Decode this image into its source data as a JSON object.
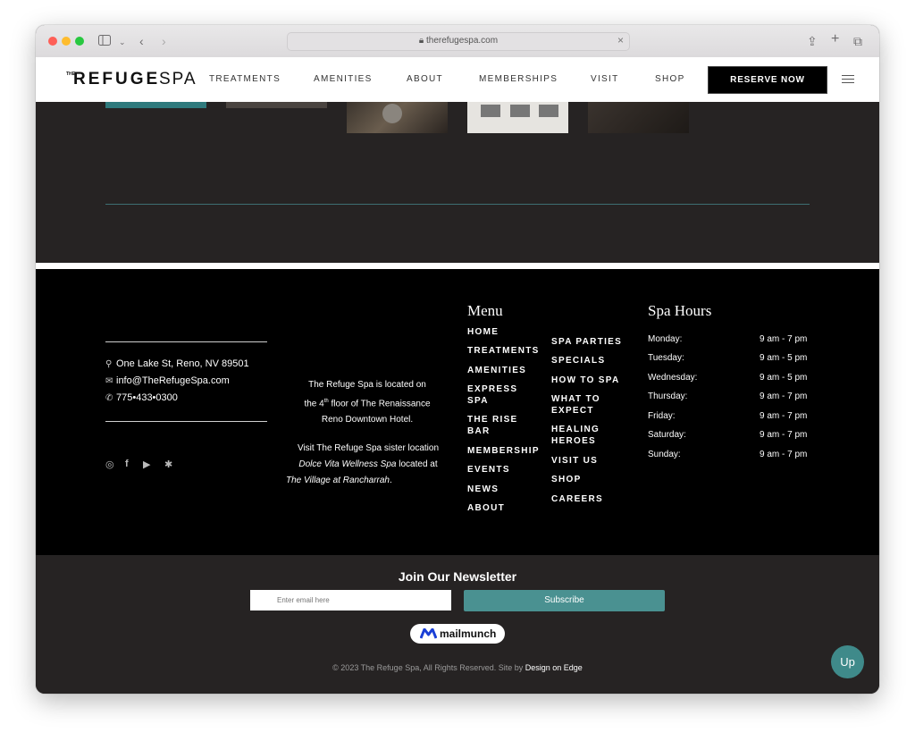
{
  "browser": {
    "url": "therefugespa.com"
  },
  "header": {
    "logo_small": "THE",
    "logo_main": "REFUGE",
    "logo_suffix": "SPA",
    "nav": [
      "TREATMENTS",
      "AMENITIES",
      "ABOUT",
      "MEMBERSHIPS",
      "VISIT",
      "SHOP"
    ],
    "reserve_label": "RESERVE NOW"
  },
  "contact": {
    "address": "One Lake St, Reno, NV 89501",
    "email": "info@TheRefugeSpa.com",
    "phone": "775•433•0300"
  },
  "about": {
    "line1": "The Refuge Spa is located on",
    "line2_pre": "the 4",
    "line2_sup": "th",
    "line2_post": " floor of The Renaissance",
    "line3": "Reno Downtown Hotel.",
    "line4": "Visit The Refuge Spa sister location",
    "line5_em": "Dolce Vita Wellness Spa",
    "line5_rest": " located at",
    "line6_em": "The Village at Rancharrah",
    "line6_rest": "."
  },
  "menu": {
    "heading": "Menu",
    "col1": [
      "HOME",
      "TREATMENTS",
      "AMENITIES",
      "EXPRESS\nSPA",
      "THE RISE\nBAR",
      "MEMBERSHIP",
      "EVENTS",
      "NEWS",
      "ABOUT"
    ],
    "col2": [
      "SPA PARTIES",
      "SPECIALS",
      "HOW TO SPA",
      "WHAT TO\nEXPECT",
      "HEALING\nHEROES",
      "VISIT US",
      "SHOP",
      "CAREERS"
    ]
  },
  "hours": {
    "heading": "Spa Hours",
    "rows": [
      {
        "day": "Monday:",
        "time": "9 am - 7 pm"
      },
      {
        "day": "Tuesday:",
        "time": "9 am - 5 pm"
      },
      {
        "day": "Wednesday:",
        "time": "9 am - 5 pm"
      },
      {
        "day": "Thursday:",
        "time": "9 am - 7 pm"
      },
      {
        "day": "Friday:",
        "time": "9 am - 7 pm"
      },
      {
        "day": "Saturday:",
        "time": "9 am - 7 pm"
      },
      {
        "day": "Sunday:",
        "time": "9 am - 7 pm"
      }
    ]
  },
  "newsletter": {
    "title": "Join Our Newsletter",
    "placeholder": "Enter email here",
    "subscribe_label": "Subscribe",
    "badge": "mailmunch"
  },
  "footer": {
    "copyright": "© 2023 The Refuge Spa, All Rights Reserved. Site by ",
    "credit": "Design on Edge",
    "up_label": "Up"
  },
  "colors": {
    "accent": "#4a9191",
    "dark": "#262323",
    "footer_bg": "#000000"
  }
}
